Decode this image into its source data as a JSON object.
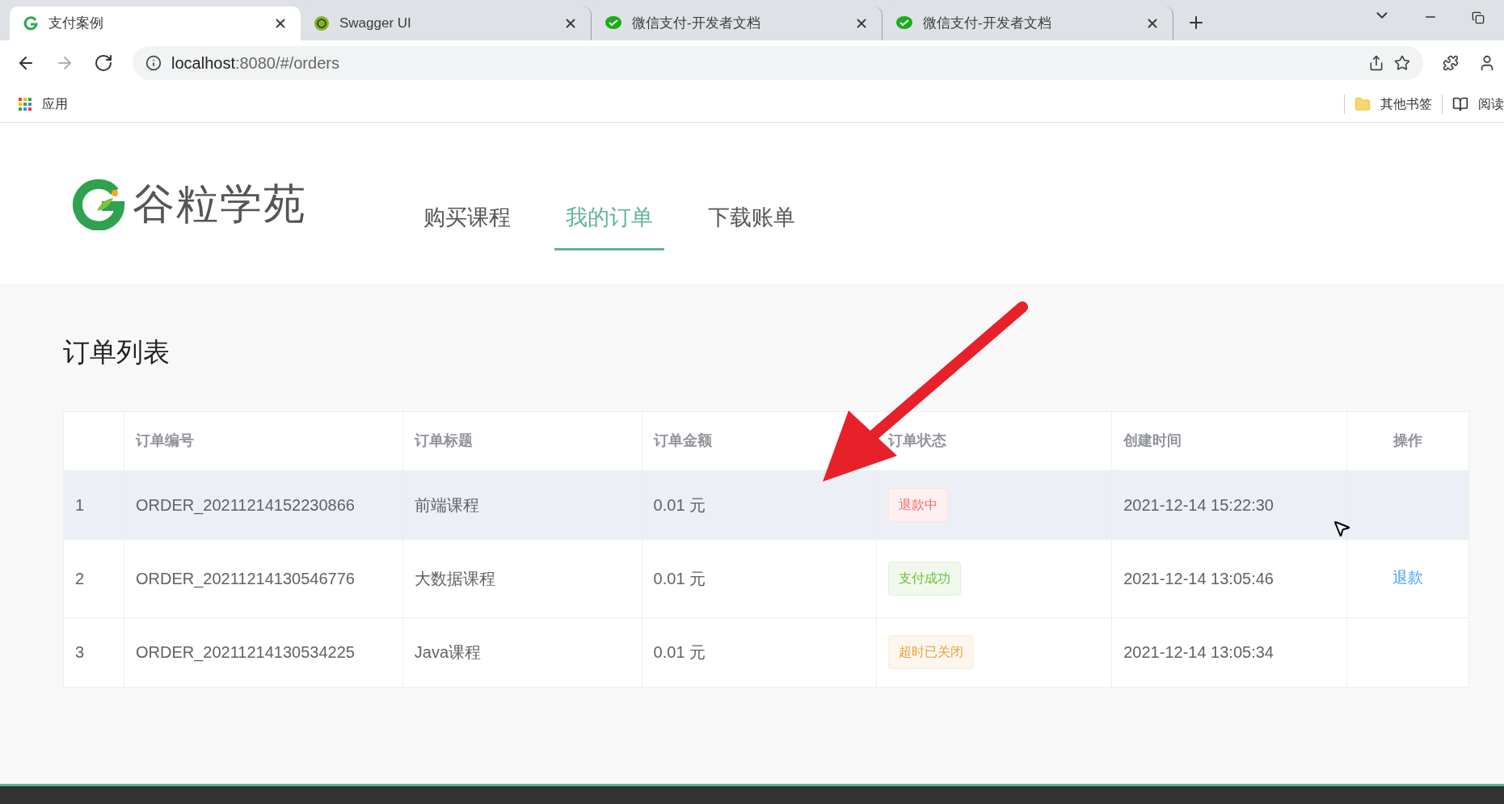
{
  "browser": {
    "tabs": [
      {
        "title": "支付案例",
        "kind": "app",
        "selected": true
      },
      {
        "title": "Swagger UI",
        "kind": "swagger",
        "selected": false
      },
      {
        "title": "微信支付-开发者文档",
        "kind": "wechat",
        "selected": false
      },
      {
        "title": "微信支付-开发者文档",
        "kind": "wechat",
        "selected": false
      }
    ],
    "nav_buttons": [
      {
        "kind": "back",
        "disabled": false
      },
      {
        "kind": "forward",
        "disabled": true
      },
      {
        "kind": "reload",
        "disabled": false
      }
    ],
    "url": {
      "host": "localhost",
      "rest": ":8080/#/orders"
    },
    "bookmarks": {
      "apps": "应用",
      "other": "其他书签",
      "reading": "阅读"
    }
  },
  "site": {
    "logo": "谷粒学苑",
    "nav": [
      {
        "label": "购买课程",
        "selected": false
      },
      {
        "label": "我的订单",
        "selected": true
      },
      {
        "label": "下载账单",
        "selected": false
      }
    ]
  },
  "orders": {
    "title": "订单列表",
    "columns": [
      "订单编号",
      "订单标题",
      "订单金额",
      "订单状态",
      "创建时间",
      "操作"
    ],
    "rows": [
      {
        "index": "1",
        "order_no": "ORDER_20211214152230866",
        "title": "前端课程",
        "amount": "0.01 元",
        "status": {
          "label": "退款中",
          "kind": "danger"
        },
        "created": "2021-12-14 15:22:30",
        "hovered": true
      },
      {
        "index": "2",
        "order_no": "ORDER_20211214130546776",
        "title": "大数据课程",
        "amount": "0.01 元",
        "status": {
          "label": "支付成功",
          "kind": "success"
        },
        "created": "2021-12-14 13:05:46",
        "action": "退款",
        "hovered": false
      },
      {
        "index": "3",
        "order_no": "ORDER_20211214130534225",
        "title": "Java课程",
        "amount": "0.01 元",
        "status": {
          "label": "超时已关闭",
          "kind": "warning"
        },
        "created": "2021-12-14 13:05:34",
        "hovered": false
      }
    ]
  }
}
